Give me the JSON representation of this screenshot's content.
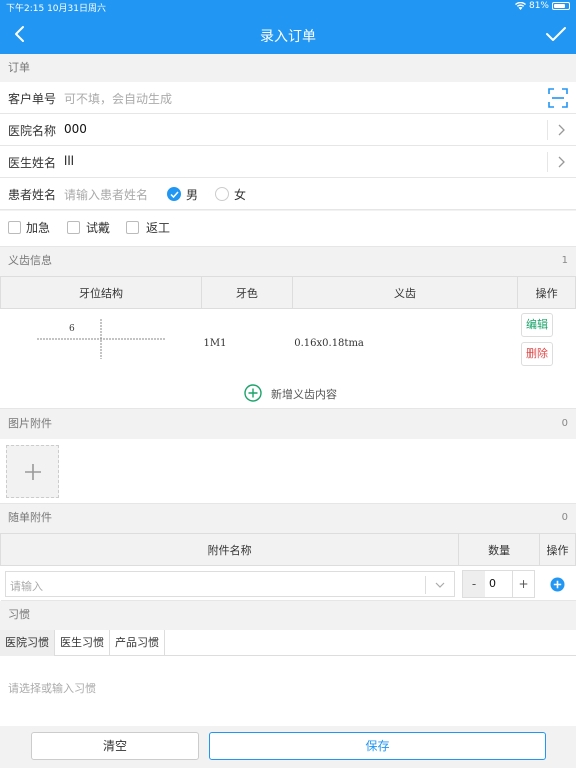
{
  "status_bar": {
    "time_date": "下午2:15   10月31日周六",
    "battery": "81%",
    "battery_level": 0.81
  },
  "nav": {
    "title": "录入订单"
  },
  "order": {
    "section_title": "订单",
    "customer_no": {
      "label": "客户单号",
      "placeholder": "可不填，会自动生成"
    },
    "hospital": {
      "label": "医院名称",
      "value": "000"
    },
    "doctor": {
      "label": "医生姓名",
      "value": "lll"
    },
    "patient": {
      "label": "患者姓名",
      "placeholder": "请输入患者姓名",
      "gender_male": "男",
      "gender_female": "女",
      "selected_gender": "男"
    },
    "flags": [
      "加急",
      "试戴",
      "返工"
    ]
  },
  "denture": {
    "section_title": "义齿信息",
    "count": "1",
    "headers": [
      "牙位结构",
      "牙色",
      "义齿",
      "操作"
    ],
    "rows": [
      {
        "tooth_position": "6",
        "shade": "1M1",
        "denture": "0.16x0.18tma",
        "edit": "编辑",
        "delete": "删除"
      }
    ],
    "add_label": "新增义齿内容"
  },
  "images": {
    "section_title": "图片附件",
    "count": "0"
  },
  "attachments": {
    "section_title": "随单附件",
    "count": "0",
    "headers": [
      "附件名称",
      "数量",
      "操作"
    ],
    "name_placeholder": "请输入",
    "minus": "-",
    "quantity": "0",
    "plus": "+"
  },
  "habits": {
    "section_title": "习惯",
    "tabs": [
      "医院习惯",
      "医生习惯",
      "产品习惯"
    ],
    "active_tab": "医院习惯",
    "placeholder": "请选择或输入习惯"
  },
  "footer": {
    "clear_label": "清空",
    "save_label": "保存"
  },
  "colors": {
    "primary": "#2196f3",
    "edit": "#1aa36a",
    "delete": "#e04848"
  }
}
